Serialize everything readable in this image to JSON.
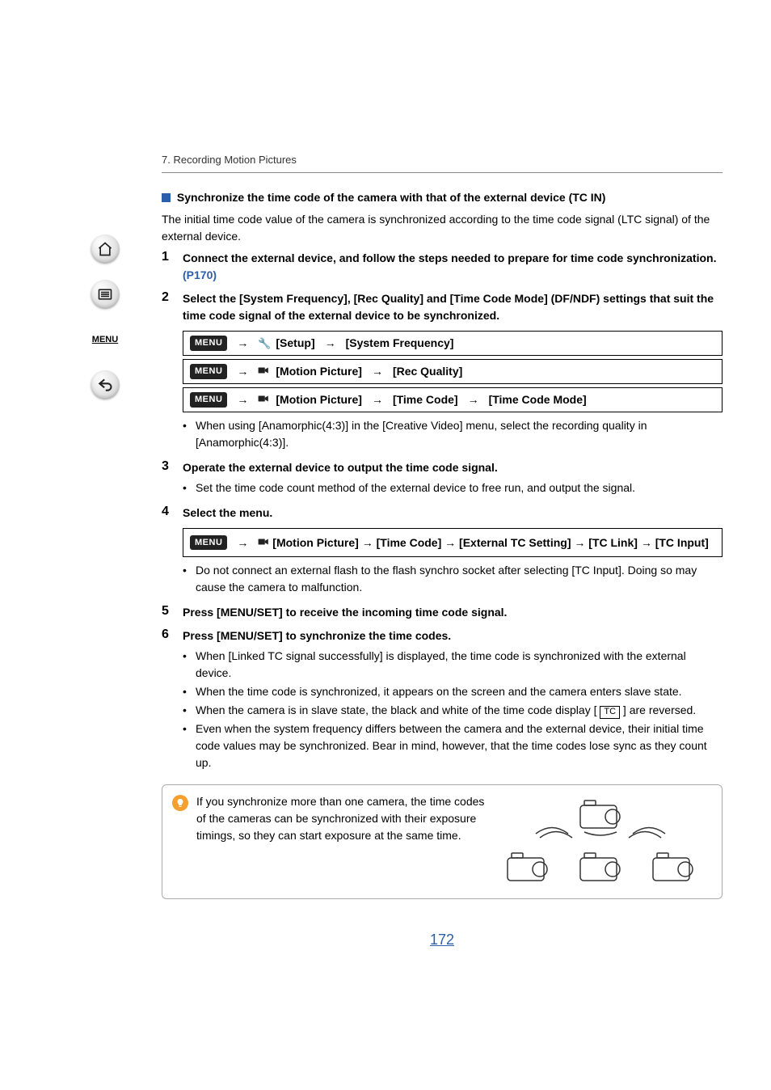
{
  "breadcrumb": "7. Recording Motion Pictures",
  "section": {
    "title": "Synchronize the time code of the camera with that of the external device (TC IN)",
    "intro": "The initial time code value of the camera is synchronized according to the time code signal (LTC signal) of the external device."
  },
  "icons": {
    "menuChip": "MENU"
  },
  "menuPaths": {
    "setup": "[Setup]",
    "systemFrequency": "[System Frequency]",
    "motionPicture": "[Motion Picture]",
    "recQuality": "[Rec Quality]",
    "timeCode": "[Time Code]",
    "timeCodeMode": "[Time Code Mode]",
    "externalTCSetting": "[External TC Setting]",
    "tcLink": "[TC Link]",
    "tcInput": "[TC Input]"
  },
  "steps": [
    {
      "num": "1",
      "title": "Connect the external device, and follow the steps needed to prepare for time code synchronization. ",
      "link": "(P170)"
    },
    {
      "num": "2",
      "title": "Select the [System Frequency], [Rec Quality] and [Time Code Mode] (DF/NDF) settings that suit the time code signal of the external device to be synchronized.",
      "menuRows": [
        "row1",
        "row2",
        "row3"
      ],
      "bullets": [
        "When using [Anamorphic(4:3)] in the [Creative Video] menu, select the recording quality in [Anamorphic(4:3)]."
      ]
    },
    {
      "num": "3",
      "title": "Operate the external device to output the time code signal.",
      "bullets": [
        "Set the time code count method of the external device to free run, and output the signal."
      ]
    },
    {
      "num": "4",
      "title": "Select the menu.",
      "menuRows": [
        "row4"
      ],
      "bullets": [
        "Do not connect an external flash to the flash synchro socket after selecting [TC Input]. Doing so may cause the camera to malfunction."
      ]
    },
    {
      "num": "5",
      "title": "Press [MENU/SET] to receive the incoming time code signal."
    },
    {
      "num": "6",
      "title": "Press [MENU/SET] to synchronize the time codes.",
      "bullets": [
        "When [Linked TC signal successfully] is displayed, the time code is synchronized with the external device.",
        "When the time code is synchronized, it appears on the screen and the camera enters slave state.",
        "_TCLINE_",
        "Even when the system frequency differs between the camera and the external device, their initial time code values may be synchronized. Bear in mind, however, that the time codes lose sync as they count up."
      ],
      "tcBullet": {
        "pre": "When the camera is in slave state, the black and white of the time code display [ ",
        "tcLabel": "TC",
        "post": " ] are reversed."
      }
    }
  ],
  "tip": {
    "text": "If you synchronize more than one camera, the time codes of the cameras can be synchronized with their exposure timings, so they can start exposure at the same time."
  },
  "pageNumber": "172"
}
